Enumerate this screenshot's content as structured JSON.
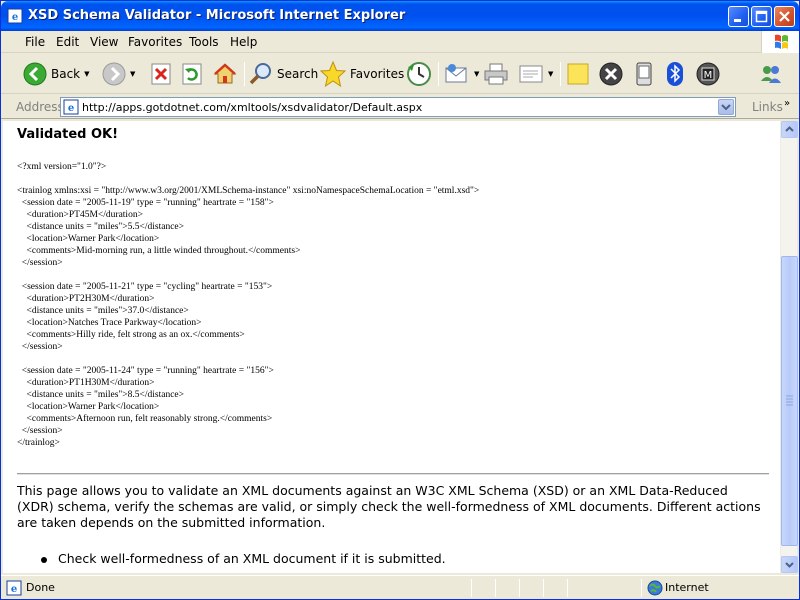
{
  "window": {
    "title": "XSD Schema Validator - Microsoft Internet Explorer"
  },
  "menu": {
    "items": [
      "File",
      "Edit",
      "View",
      "Favorites",
      "Tools",
      "Help"
    ]
  },
  "toolbar": {
    "back_label": "Back",
    "search_label": "Search",
    "favorites_label": "Favorites"
  },
  "address": {
    "label": "Address",
    "url": "http://apps.gotdotnet.com/xmltools/xsdvalidator/Default.aspx",
    "links_label": "Links"
  },
  "content": {
    "status_heading": "Validated OK!",
    "xml_lines": [
      "<?xml version=\"1.0\"?>",
      "",
      "<trainlog xmlns:xsi = \"http://www.w3.org/2001/XMLSchema-instance\" xsi:noNamespaceSchemaLocation = \"etml.xsd\">",
      "  <session date = \"2005-11-19\" type = \"running\" heartrate = \"158\">",
      "    <duration>PT45M</duration>",
      "    <distance units = \"miles\">5.5</distance>",
      "    <location>Warner Park</location>",
      "    <comments>Mid-morning run, a little winded throughout.</comments>",
      "  </session>",
      "",
      "  <session date = \"2005-11-21\" type = \"cycling\" heartrate = \"153\">",
      "    <duration>PT2H30M</duration>",
      "    <distance units = \"miles\">37.0</distance>",
      "    <location>Natches Trace Parkway</location>",
      "    <comments>Hilly ride, felt strong as an ox.</comments>",
      "  </session>",
      "",
      "  <session date = \"2005-11-24\" type = \"running\" heartrate = \"156\">",
      "    <duration>PT1H30M</duration>",
      "    <distance units = \"miles\">8.5</distance>",
      "    <location>Warner Park</location>",
      "    <comments>Afternoon run, felt reasonably strong.</comments>",
      "  </session>",
      "</trainlog>"
    ],
    "description": "This page allows you to validate an XML documents against an W3C XML Schema (XSD) or an XML Data-Reduced (XDR) schema, verify the schemas are valid, or simply check the well-formedness of XML documents. Different actions are taken depends on the submitted information.",
    "bullets": [
      "Check well-formedness of an XML document if it is submitted."
    ]
  },
  "status": {
    "text": "Done",
    "zone": "Internet"
  },
  "colors": {
    "titlebar": "#0053ee",
    "chrome": "#ece9d8"
  }
}
